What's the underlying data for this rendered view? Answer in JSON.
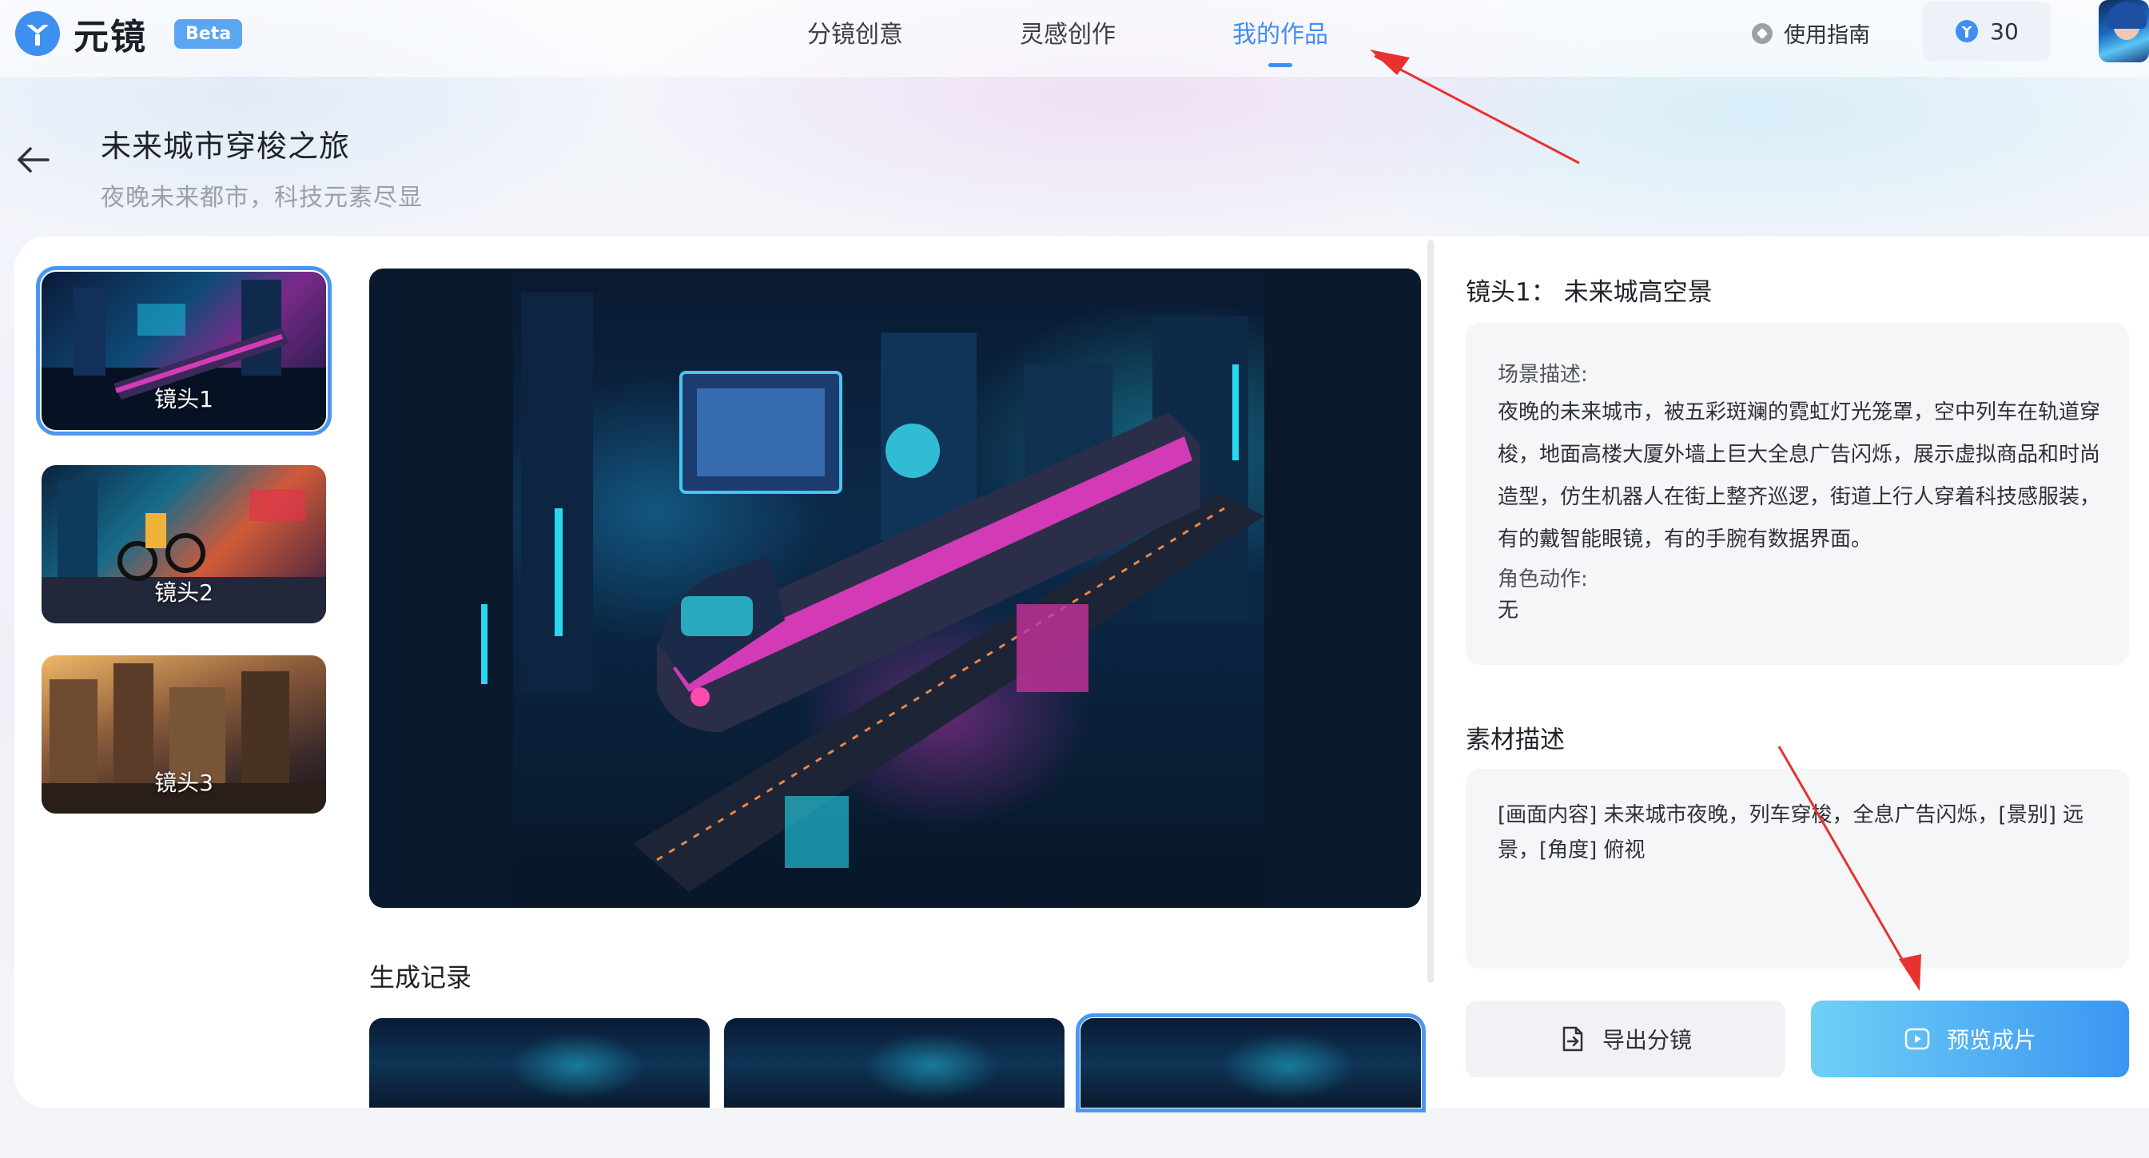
{
  "app": {
    "name": "元镜",
    "badge": "Beta"
  },
  "nav": {
    "tabs": [
      {
        "label": "分镜创意"
      },
      {
        "label": "灵感创作"
      },
      {
        "label": "我的作品"
      }
    ],
    "active_tab": "我的作品",
    "guide_label": "使用指南",
    "credits": "30"
  },
  "project": {
    "title": "未来城市穿梭之旅",
    "subtitle": "夜晚未来都市，科技元素尽显"
  },
  "shots": [
    {
      "label": "镜头1",
      "selected": true
    },
    {
      "label": "镜头2",
      "selected": false
    },
    {
      "label": "镜头3",
      "selected": false
    }
  ],
  "history": {
    "title": "生成记录",
    "items_selected_index": 2
  },
  "detail": {
    "heading": "镜头1： 未来城高空景",
    "scene_label": "场景描述:",
    "scene_text": "夜晚的未来城市，被五彩斑斓的霓虹灯光笼罩，空中列车在轨道穿梭，地面高楼大厦外墙上巨大全息广告闪烁，展示虚拟商品和时尚造型，仿生机器人在街上整齐巡逻，街道上行人穿着科技感服装，有的戴智能眼镜，有的手腕有数据界面。",
    "action_label": "角色动作:",
    "action_text": "无",
    "material_title": "素材描述",
    "material_text": "[画面内容] 未来城市夜晚，列车穿梭，全息广告闪烁，[景别] 远景，[角度] 俯视"
  },
  "buttons": {
    "export_label": "导出分镜",
    "preview_label": "预览成片"
  },
  "colors": {
    "accent": "#3e8ef0",
    "annotation_arrow": "#e8322f"
  }
}
